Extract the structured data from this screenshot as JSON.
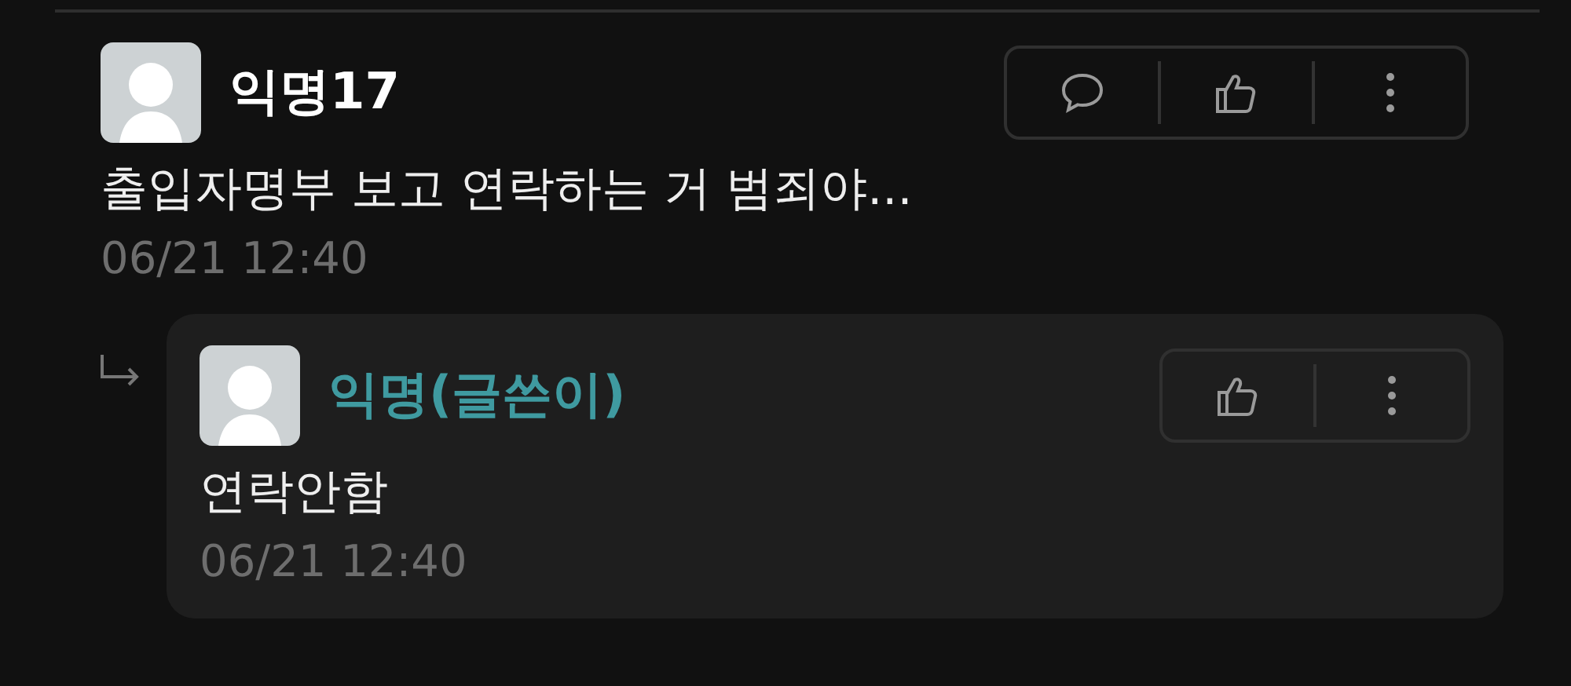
{
  "comments": [
    {
      "author": "익명17",
      "op": false,
      "text": "출입자명부 보고 연락하는 거 범죄야...",
      "time": "06/21 12:40",
      "actions": [
        {
          "kind": "comment"
        },
        {
          "kind": "like"
        },
        {
          "kind": "more"
        }
      ],
      "replies": [
        {
          "author": "익명(글쓴이)",
          "op": true,
          "text": "연락안함",
          "time": "06/21 12:40",
          "actions": [
            {
              "kind": "like"
            },
            {
              "kind": "more"
            }
          ]
        }
      ]
    }
  ]
}
